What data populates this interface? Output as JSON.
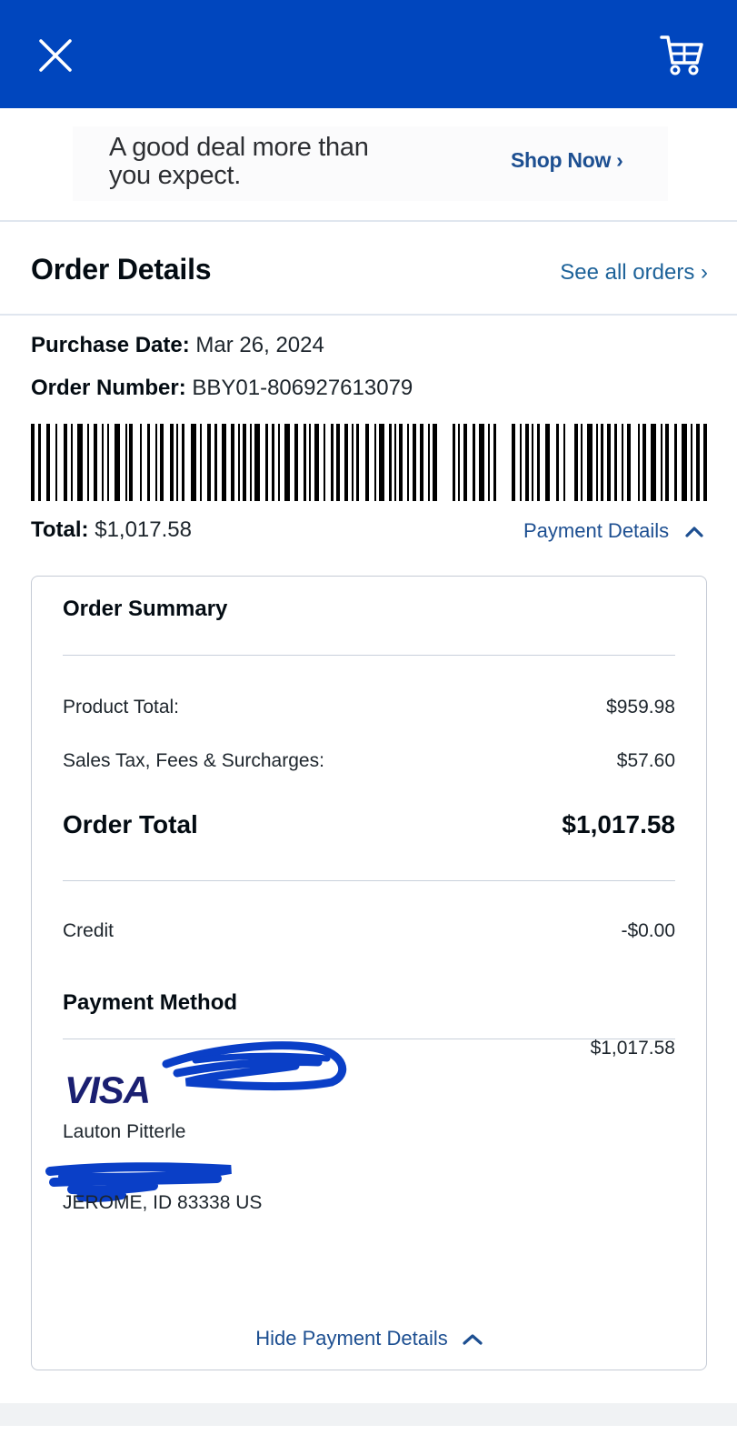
{
  "colors": {
    "brand_blue": "#0046be",
    "link_blue": "#1d4f91",
    "visa_navy": "#1a1f71"
  },
  "topbar": {
    "close_icon": "close-icon",
    "cart_icon": "cart-icon"
  },
  "promo": {
    "text": "A good deal more than\nyou expect.",
    "cta": "Shop Now ›"
  },
  "header": {
    "title": "Order Details",
    "see_all": "See all orders ›"
  },
  "order": {
    "purchase_date_label": "Purchase Date:",
    "purchase_date": "Mar 26, 2024",
    "order_number_label": "Order Number:",
    "order_number": "BBY01-806927613079",
    "total_label": "Total:",
    "total": "$1,017.58",
    "payment_details_label": "Payment Details"
  },
  "summary": {
    "title": "Order Summary",
    "rows": [
      {
        "label": "Product Total:",
        "value": "$959.98"
      },
      {
        "label": "Sales Tax, Fees & Surcharges:",
        "value": "$57.60"
      }
    ],
    "order_total_label": "Order Total",
    "order_total": "$1,017.58",
    "credit_label": "Credit",
    "credit_value": "-$0.00"
  },
  "payment": {
    "title": "Payment Method",
    "card_brand": "VISA",
    "amount": "$1,017.58",
    "name": "Lauton Pitterle",
    "city_line": "JEROME, ID  83338 US",
    "hide_label": "Hide Payment Details"
  }
}
